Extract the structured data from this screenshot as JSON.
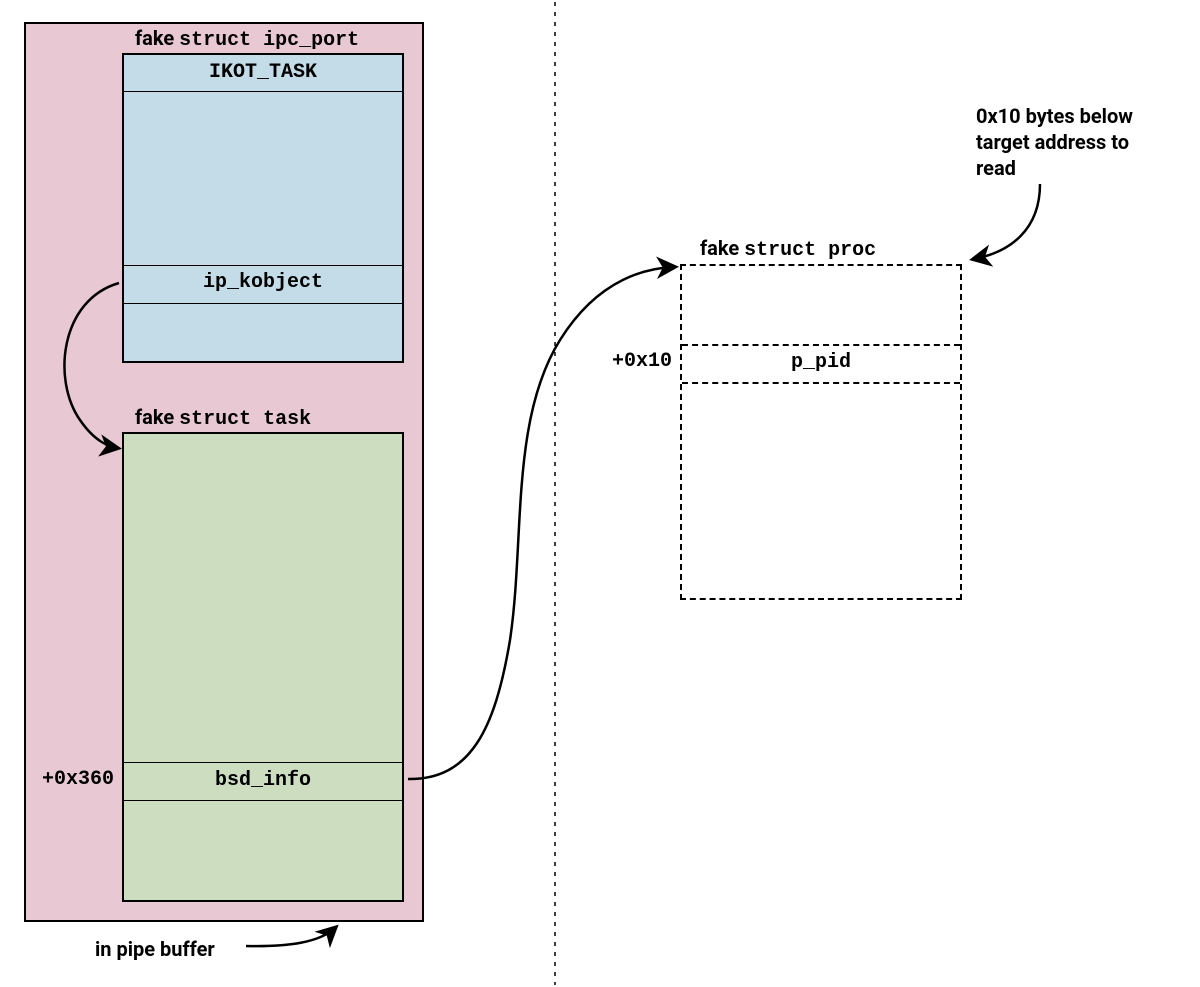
{
  "labels": {
    "ipc_port_header_prefix": "fake ",
    "ipc_port_header_mono": "struct ipc_port",
    "task_header_prefix": "fake ",
    "task_header_mono": "struct task",
    "proc_header_prefix": "fake ",
    "proc_header_mono": "struct proc",
    "ikot_task": "IKOT_TASK",
    "ip_kobject": "ip_kobject",
    "bsd_info": "bsd_info",
    "p_pid": "p_pid",
    "offset_task": "+0x360",
    "offset_proc": "+0x10",
    "pipe_buffer": "in pipe buffer",
    "annotation_line1": "0x10 bytes below",
    "annotation_line2": "target address to",
    "annotation_line3": "read"
  },
  "colors": {
    "pink": "#e8c8d3",
    "blue": "#c3dce7",
    "green": "#ccddc0"
  }
}
